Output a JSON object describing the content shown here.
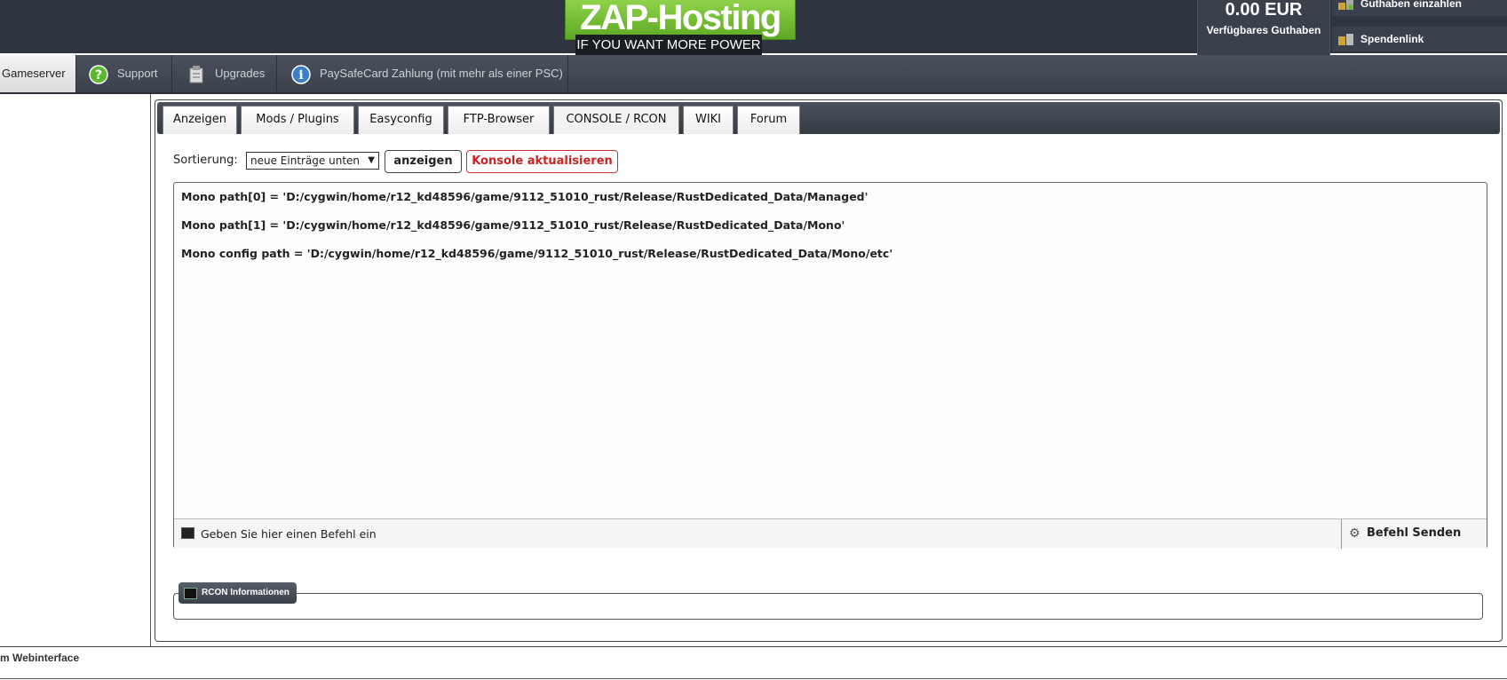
{
  "header": {
    "logo_text": "ZAP-Hosting",
    "logo_tagline": "IF YOU WANT MORE POWER",
    "balance_amount": "0.00 EUR",
    "balance_label": "Verfügbares Guthaben",
    "links": [
      {
        "label": "Guthaben einzahlen",
        "icon": "coins-icon"
      },
      {
        "label": "Spendenlink",
        "icon": "money-icon"
      }
    ]
  },
  "nav": {
    "items": [
      {
        "label": "Gameserver",
        "active": true
      },
      {
        "label": "Support",
        "icon": "question-icon"
      },
      {
        "label": "Upgrades",
        "icon": "upgrade-icon"
      },
      {
        "label": "PaySafeCard Zahlung (mit mehr als einer PSC)",
        "icon": "info-icon"
      }
    ]
  },
  "tabs": [
    {
      "label": "Anzeigen"
    },
    {
      "label": "Mods / Plugins"
    },
    {
      "label": "Easyconfig"
    },
    {
      "label": "FTP-Browser"
    },
    {
      "label": "CONSOLE / RCON",
      "active": true
    },
    {
      "label": "WIKI"
    },
    {
      "label": "Forum"
    }
  ],
  "sort": {
    "label": "Sortierung:",
    "selected": "neue Einträge unten",
    "show_button": "anzeigen",
    "refresh_button": "Konsole aktualisieren"
  },
  "console": {
    "lines": [
      "Mono path[0] = 'D:/cygwin/home/r12_kd48596/game/9112_51010_rust/Release/RustDedicated_Data/Managed'",
      "Mono path[1] = 'D:/cygwin/home/r12_kd48596/game/9112_51010_rust/Release/RustDedicated_Data/Mono'",
      "Mono config path = 'D:/cygwin/home/r12_kd48596/game/9112_51010_rust/Release/RustDedicated_Data/Mono/etc'"
    ],
    "command_placeholder": "Geben Sie hier einen Befehl ein",
    "send_button": "Befehl Senden"
  },
  "rcon": {
    "legend": "RCON Informationen"
  },
  "footer": {
    "text": "m Webinterface"
  },
  "colors": {
    "header_bg": "#2f3540",
    "logo_green": "#7cc23a",
    "refresh_red": "#cc2222"
  }
}
